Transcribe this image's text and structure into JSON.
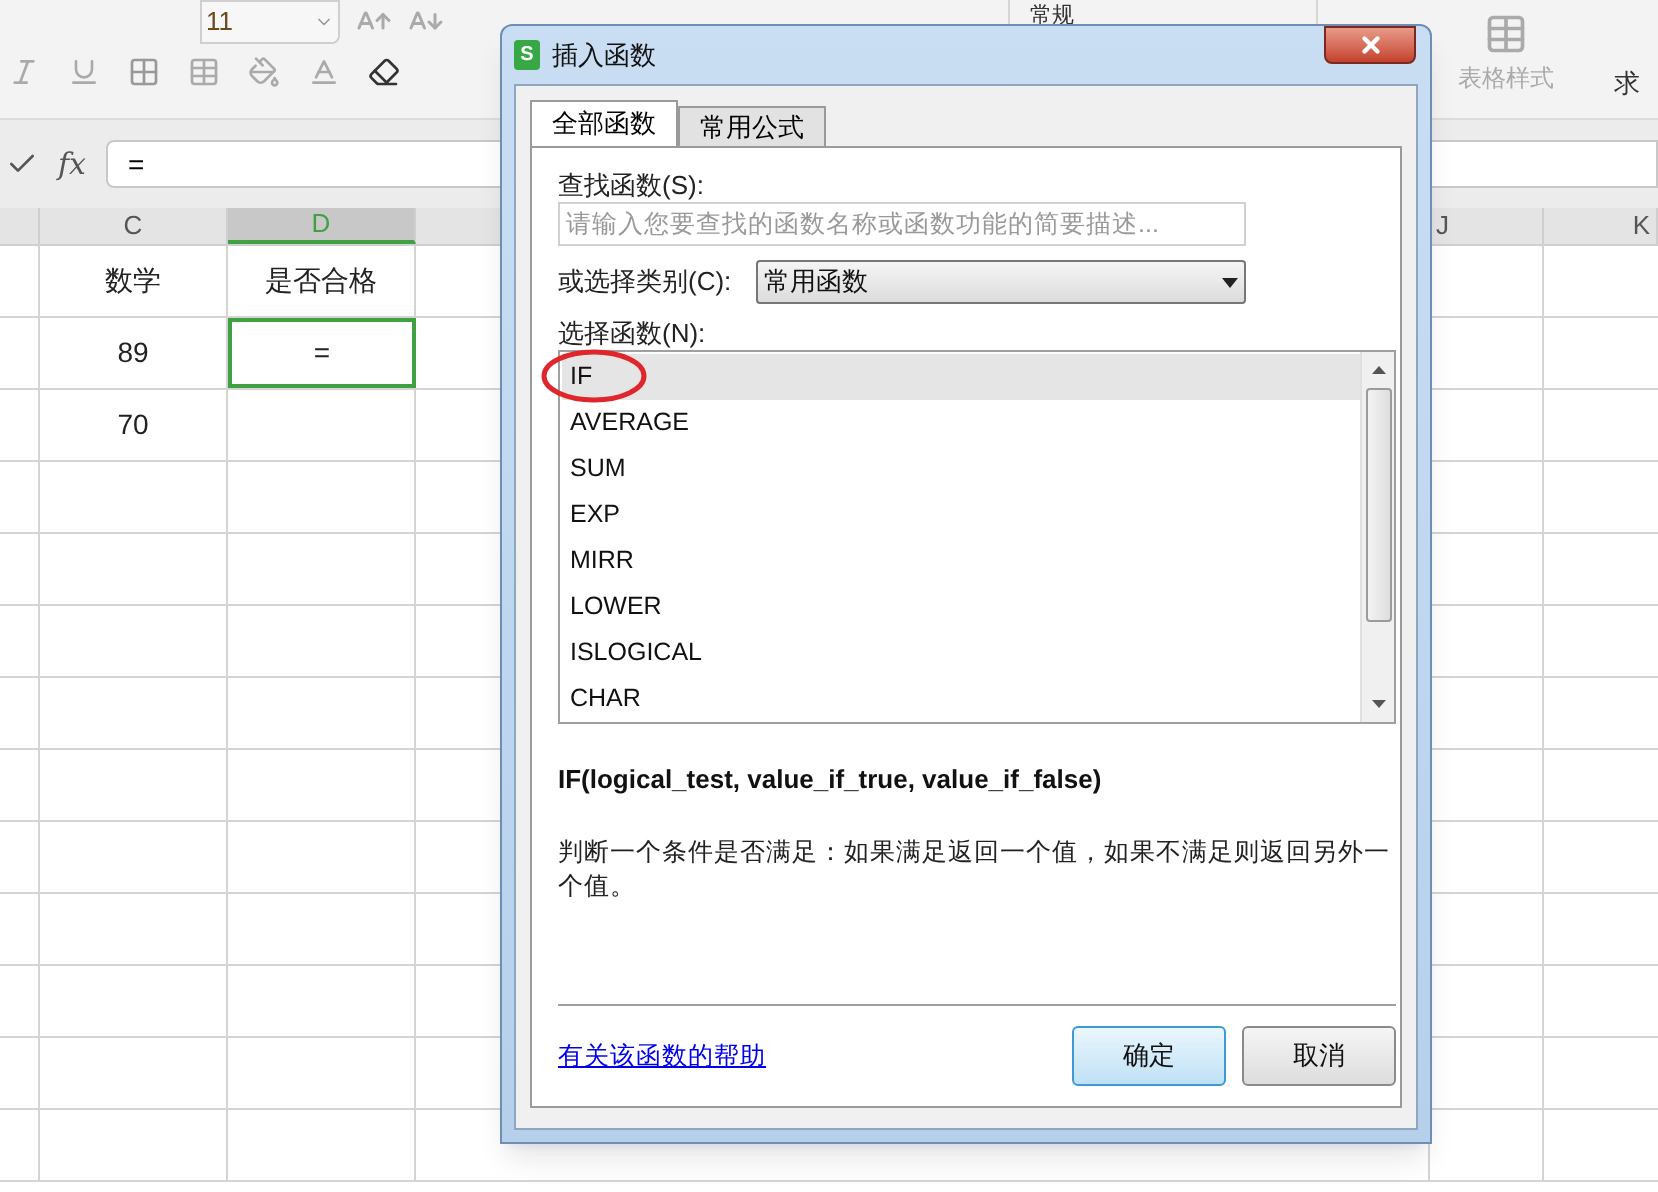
{
  "ribbon": {
    "font_size": "11",
    "number_format": "常规",
    "table_style": "表格样式",
    "cut_label": "求"
  },
  "formula_bar": {
    "fx": "fx",
    "value": "="
  },
  "sheet": {
    "columns": [
      {
        "label": "C",
        "selected": false
      },
      {
        "label": "D",
        "selected": true
      },
      {
        "label": "J",
        "selected": false
      },
      {
        "label": "K",
        "selected": false
      }
    ],
    "rows": [
      [
        {
          "text": "数学",
          "selected": false
        },
        {
          "text": "是否合格",
          "selected": false
        }
      ],
      [
        {
          "text": "89",
          "selected": false
        },
        {
          "text": "=",
          "selected": true
        }
      ],
      [
        {
          "text": "70",
          "selected": false
        }
      ]
    ]
  },
  "dialog": {
    "logo_letter": "S",
    "title": "插入函数",
    "tabs": [
      {
        "label": "全部函数",
        "selected": true
      },
      {
        "label": "常用公式",
        "selected": false
      }
    ],
    "search": {
      "label": "查找函数(S):",
      "placeholder": "请输入您要查找的函数名称或函数功能的简要描述..."
    },
    "category": {
      "label": "或选择类别(C):",
      "value": "常用函数"
    },
    "functions": {
      "label": "选择函数(N):",
      "items": [
        {
          "name": "IF",
          "selected": true
        },
        {
          "name": "AVERAGE",
          "selected": false
        },
        {
          "name": "SUM",
          "selected": false
        },
        {
          "name": "EXP",
          "selected": false
        },
        {
          "name": "MIRR",
          "selected": false
        },
        {
          "name": "LOWER",
          "selected": false
        },
        {
          "name": "ISLOGICAL",
          "selected": false
        },
        {
          "name": "CHAR",
          "selected": false
        }
      ]
    },
    "signature": "IF(logical_test, value_if_true, value_if_false)",
    "description": "判断一个条件是否满足：如果满足返回一个值，如果不满足则返回另外一个值。",
    "help_link": "有关该函数的帮助",
    "buttons": [
      {
        "label": "确定",
        "default": true
      },
      {
        "label": "取消",
        "default": false
      }
    ]
  }
}
